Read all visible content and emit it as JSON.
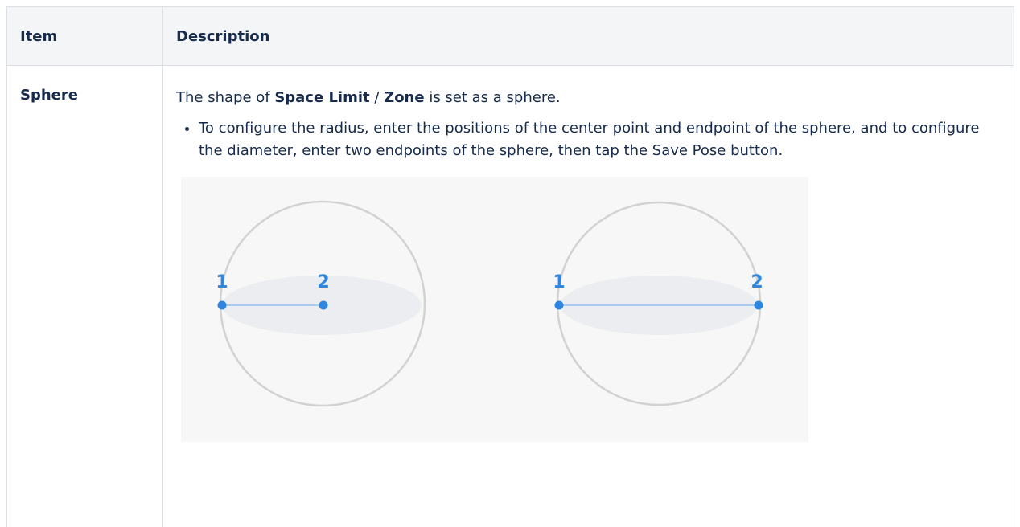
{
  "table": {
    "headers": {
      "item": "Item",
      "description": "Description"
    },
    "rows": [
      {
        "item": "Sphere",
        "intro_prefix": "The shape of ",
        "intro_bold_1": "Space Limit",
        "intro_sep": " / ",
        "intro_bold_2": "Zone",
        "intro_suffix": " is set as a sphere.",
        "bullets": [
          "To configure the radius, enter the positions of the center point and endpoint of the sphere, and to configure the diameter, enter two endpoints of the sphere, then tap the Save Pose button."
        ],
        "figure": {
          "left": {
            "label_start": "1",
            "label_end": "2"
          },
          "right": {
            "label_start": "1",
            "label_end": "2"
          }
        }
      }
    ]
  },
  "colors": {
    "header_bg": "#f4f5f7",
    "border": "#dcdfe4",
    "point": "#2d86e0",
    "line": "#a9cdf2",
    "sphere_outline": "#d2d2d2",
    "ellipse_fill": "#ebedf0"
  }
}
